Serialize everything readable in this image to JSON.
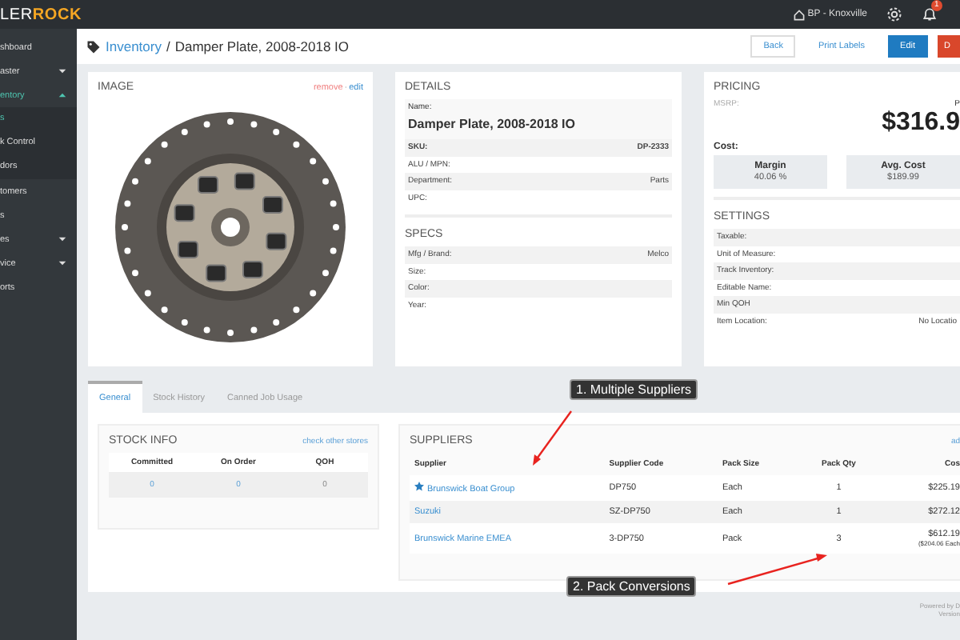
{
  "topbar": {
    "logo_light": "LER",
    "logo_bold": "ROCK",
    "location": "BP - Knoxville",
    "notification_count": "1"
  },
  "sidebar": {
    "items": [
      {
        "label": "shboard",
        "kind": "link",
        "selected": false
      },
      {
        "label": "aster",
        "kind": "group",
        "expanded": false,
        "selected": false
      },
      {
        "label": "entory",
        "kind": "group",
        "expanded": true,
        "selected": true,
        "children": [
          {
            "label": "s",
            "selected": true
          },
          {
            "label": "k Control",
            "selected": false
          },
          {
            "label": "dors",
            "selected": false
          }
        ]
      },
      {
        "label": "tomers",
        "kind": "link",
        "selected": false
      },
      {
        "label": "s",
        "kind": "link",
        "selected": false
      },
      {
        "label": "es",
        "kind": "group",
        "expanded": false,
        "selected": false
      },
      {
        "label": "vice",
        "kind": "group",
        "expanded": false,
        "selected": false
      },
      {
        "label": "orts",
        "kind": "link",
        "selected": false
      }
    ]
  },
  "breadcrumb": {
    "link": "Inventory",
    "separator": "/",
    "current": "Damper Plate, 2008-2018 IO"
  },
  "actions": [
    {
      "label": "Back",
      "kind": "outline"
    },
    {
      "label": "Print Labels",
      "kind": "link"
    },
    {
      "label": "Edit",
      "kind": "primary"
    },
    {
      "label": "D",
      "kind": "danger"
    }
  ],
  "image_card": {
    "title": "IMAGE",
    "remove": "remove",
    "separator": "·",
    "edit": "edit"
  },
  "details": {
    "title": "DETAILS",
    "name_label": "Name:",
    "name": "Damper Plate, 2008-2018 IO",
    "fields": [
      {
        "label": "SKU:",
        "value": "DP-2333",
        "bold": true
      },
      {
        "label": "ALU / MPN:",
        "bold": false
      },
      {
        "label": "Department:",
        "value": "Parts",
        "bold": false
      },
      {
        "label": "UPC:",
        "bold": false
      }
    ]
  },
  "specs": {
    "title": "SPECS",
    "fields": [
      {
        "label": "Mfg / Brand:",
        "value": "Melco"
      },
      {
        "label": "Size:"
      },
      {
        "label": "Color:"
      },
      {
        "label": "Year:"
      }
    ]
  },
  "pricing": {
    "title": "PRICING",
    "msrp_label": "MSRP:",
    "price_caption": "P",
    "price": "$316.9",
    "cost_label": "Cost:",
    "stats": [
      {
        "label": "Margin",
        "value": "40.06 %"
      },
      {
        "label": "Avg. Cost",
        "value": "$189.99"
      }
    ]
  },
  "settings": {
    "title": "SETTINGS",
    "fields": [
      {
        "label": "Taxable:"
      },
      {
        "label": "Unit of Measure:"
      },
      {
        "label": "Track Inventory:"
      },
      {
        "label": "Editable Name:"
      },
      {
        "label": "Min QOH"
      },
      {
        "label": "Item Location:",
        "value": "No Locatio"
      }
    ]
  },
  "tabs": [
    {
      "label": "General",
      "selected": true
    },
    {
      "label": "Stock History",
      "selected": false
    },
    {
      "label": "Canned Job Usage",
      "selected": false
    }
  ],
  "stock_info": {
    "title": "STOCK INFO",
    "link": "check other stores",
    "columns": [
      "Committed",
      "On Order",
      "QOH"
    ],
    "values": [
      {
        "value": "0",
        "link": true
      },
      {
        "value": "0",
        "link": true
      },
      {
        "value": "0",
        "link": false
      }
    ]
  },
  "suppliers": {
    "title": "SUPPLIERS",
    "add": "ad",
    "columns": [
      "Supplier",
      "Supplier Code",
      "Pack Size",
      "Pack Qty",
      "Cos"
    ],
    "rows": [
      {
        "supplier": "Brunswick Boat Group",
        "preferred": true,
        "code": "DP750",
        "pack_size": "Each",
        "pack_qty": "1",
        "cost": "$225.19"
      },
      {
        "supplier": "Suzuki",
        "preferred": false,
        "code": "SZ-DP750",
        "pack_size": "Each",
        "pack_qty": "1",
        "cost": "$272.12"
      },
      {
        "supplier": "Brunswick Marine EMEA",
        "preferred": false,
        "code": "3-DP750",
        "pack_size": "Pack",
        "pack_qty": "3",
        "cost": "$612.19",
        "cost_note": "($204.06 Each"
      }
    ]
  },
  "annotations": [
    {
      "label": "1. Multiple Suppliers"
    },
    {
      "label": "2. Pack Conversions"
    }
  ],
  "footer": {
    "powered": "Powered by D",
    "version": "Version"
  }
}
